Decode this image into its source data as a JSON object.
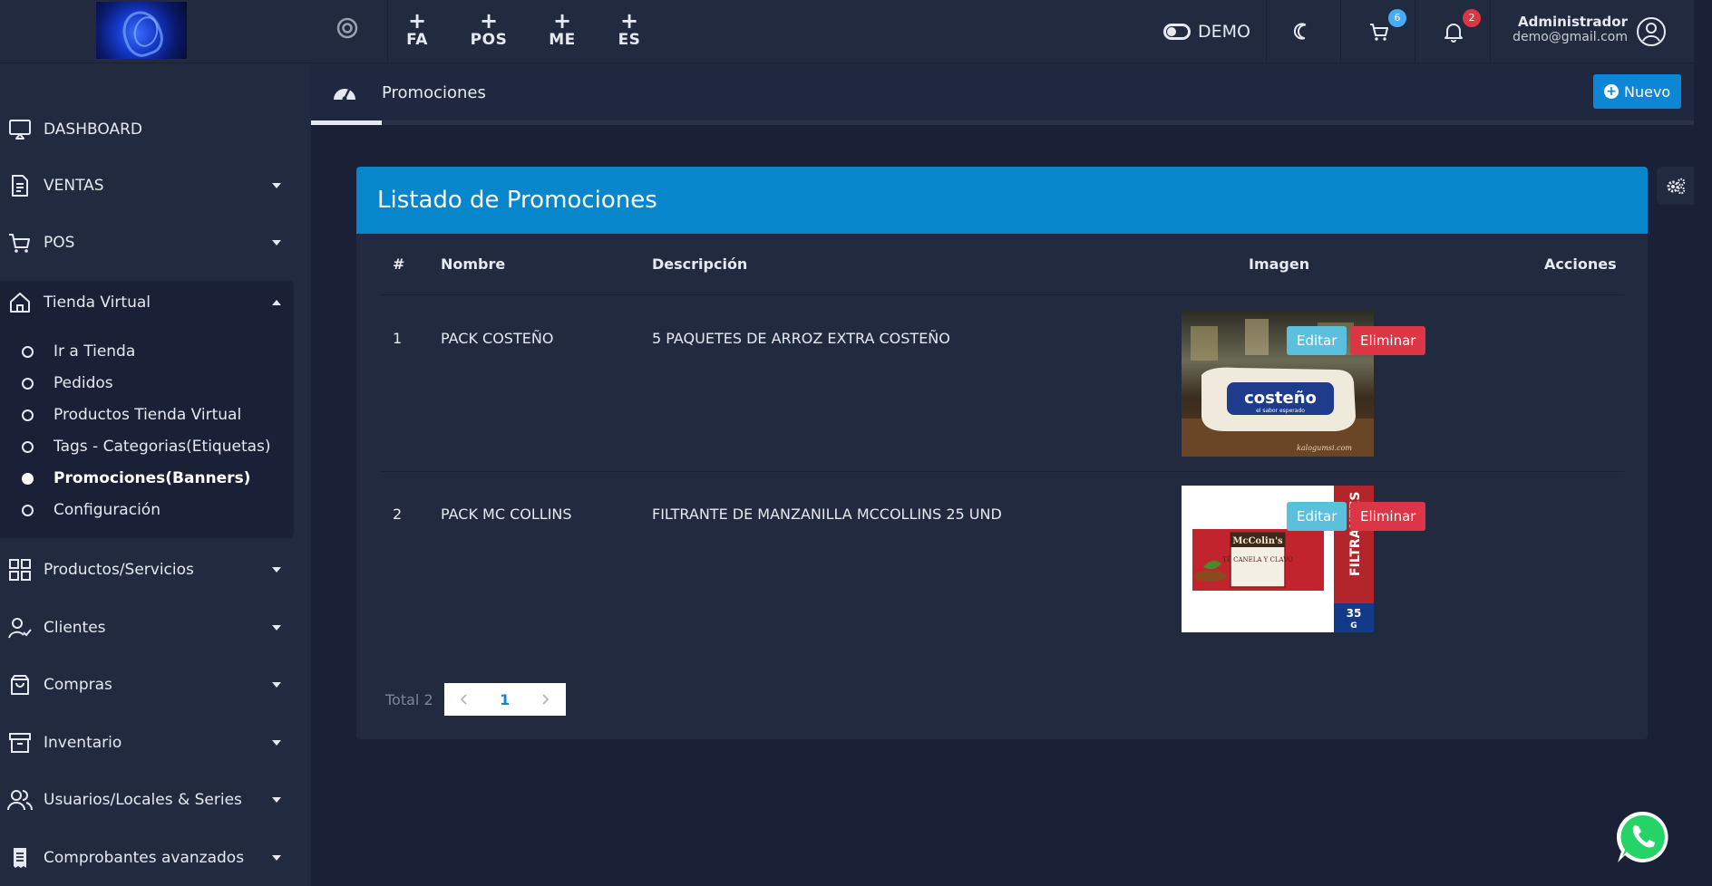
{
  "topbar": {
    "quick_links": [
      {
        "plus": "+",
        "label": "FA"
      },
      {
        "plus": "+",
        "label": "POS"
      },
      {
        "plus": "+",
        "label": "ME"
      },
      {
        "plus": "+",
        "label": "ES"
      }
    ],
    "demo_label": "DEMO",
    "cart_count": "6",
    "notification_count": "2",
    "user_name": "Administrador",
    "user_email": "demo@gmail.com"
  },
  "sidebar": {
    "items": [
      {
        "label": "DASHBOARD",
        "icon": "monitor-icon"
      },
      {
        "label": "VENTAS",
        "icon": "document-icon"
      },
      {
        "label": "POS",
        "icon": "cart-icon"
      },
      {
        "label": "Tienda Virtual",
        "icon": "home-icon"
      },
      {
        "label": "Productos/Servicios",
        "icon": "grid-icon"
      },
      {
        "label": "Clientes",
        "icon": "user-check-icon"
      },
      {
        "label": "Compras",
        "icon": "shopping-bag-icon"
      },
      {
        "label": "Inventario",
        "icon": "archive-icon"
      },
      {
        "label": "Usuarios/Locales & Series",
        "icon": "users-icon"
      },
      {
        "label": "Comprobantes avanzados",
        "icon": "receipt-icon"
      }
    ],
    "tienda_sub": [
      {
        "label": "Ir a Tienda"
      },
      {
        "label": "Pedidos"
      },
      {
        "label": "Productos Tienda Virtual"
      },
      {
        "label": "Tags - Categorias(Etiquetas)"
      },
      {
        "label": "Promociones(Banners)"
      },
      {
        "label": "Configuración"
      }
    ]
  },
  "page": {
    "title": "Promociones",
    "new_button": "Nuevo"
  },
  "card": {
    "title": "Listado de Promociones",
    "columns": [
      "#",
      "Nombre",
      "Descripción",
      "Imagen",
      "Acciones"
    ],
    "rows": [
      {
        "num": "1",
        "name": "PACK COSTEÑO",
        "description": "5 PAQUETES DE ARROZ EXTRA COSTEÑO",
        "image_brand": "costeño",
        "image_tagline": "el sabor esperado",
        "image_watermark": "kalogumsi.com"
      },
      {
        "num": "2",
        "name": "PACK MC COLLINS",
        "description": "FILTRANTE DE MANZANILLA MCCOLLINS 25 UND",
        "image_brand": "McColin's",
        "image_product": "TÉ CANELA Y CLAVO",
        "image_side": "FILTRANTES",
        "image_weight": "35",
        "image_unit": "G"
      }
    ],
    "edit_label": "Editar",
    "delete_label": "Eliminar",
    "total_label": "Total 2",
    "current_page": "1"
  },
  "colors": {
    "accent": "#0786cc",
    "sidebar_bg": "#222a3f",
    "page_bg": "#1a2035",
    "edit": "#5bc0de",
    "delete": "#dc3545"
  }
}
